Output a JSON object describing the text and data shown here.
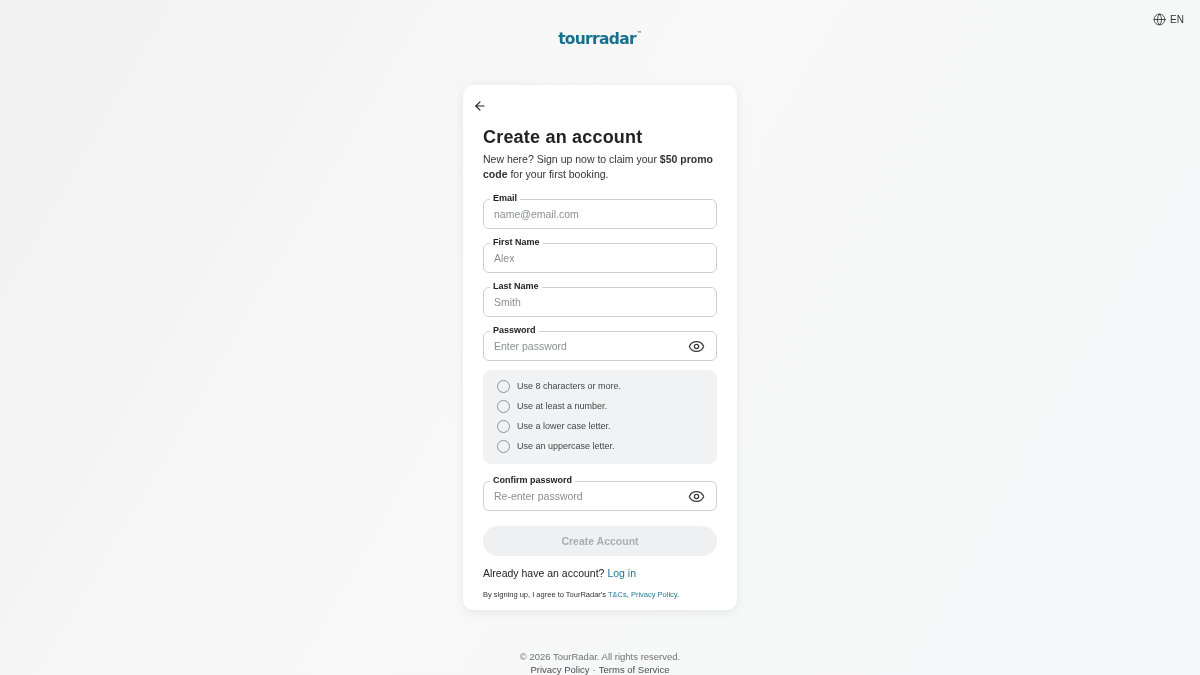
{
  "header": {
    "logo": {
      "text": "tourradar",
      "mark": "™"
    },
    "language": "EN"
  },
  "card": {
    "title": "Create an account",
    "subtitle": "New here? Sign up now to claim your **$50 promo code** for your first booking.",
    "form": {
      "fields": [
        {
          "kind": "text",
          "label": "Email",
          "placeholder": "name@email.com"
        },
        {
          "kind": "text",
          "label": "First Name",
          "placeholder": "Alex"
        },
        {
          "kind": "text",
          "label": "Last Name",
          "placeholder": "Smith"
        },
        {
          "kind": "password",
          "label": "Password",
          "placeholder": "Enter password"
        }
      ],
      "password_rules": [
        {
          "text": "Use 8 characters or more.",
          "met": false
        },
        {
          "text": "Use at least a number.",
          "met": false
        },
        {
          "text": "Use a lower case letter.",
          "met": false
        },
        {
          "text": "Use an uppercase letter.",
          "met": false
        }
      ],
      "confirm_field": {
        "kind": "password",
        "label": "Confirm password",
        "placeholder": "Re-enter password"
      },
      "submit": {
        "label": "Create Account",
        "disabled": true
      }
    },
    "login_prompt": {
      "text": "Already have an account?",
      "link": "Log in"
    },
    "terms": [
      {
        "kind": "text",
        "text": "By signing up, I agree to TourRadar's "
      },
      {
        "kind": "link",
        "text": "T&Cs"
      },
      {
        "kind": "text",
        "text": ", "
      },
      {
        "kind": "link",
        "text": "Privacy Policy"
      },
      {
        "kind": "text",
        "text": "."
      }
    ]
  },
  "footer": {
    "copyright": "© 2026 TourRadar. All rights reserved.",
    "links": [
      "Privacy Policy",
      "Terms of Service"
    ],
    "separator": "·"
  }
}
